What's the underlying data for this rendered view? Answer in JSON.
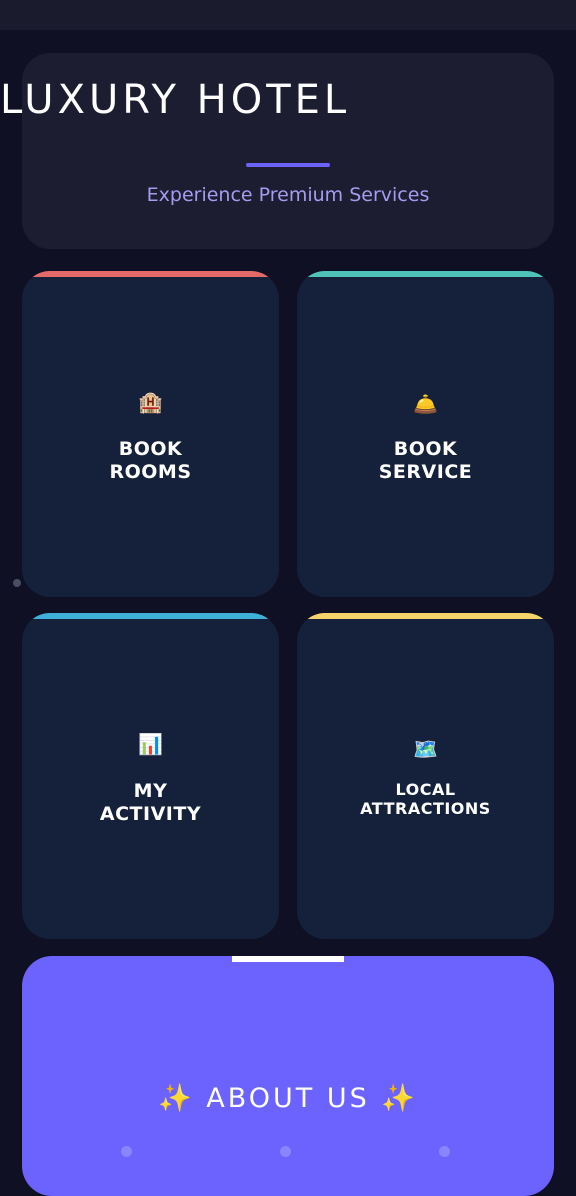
{
  "header": {
    "title": "LUXURY HOTEL",
    "subtitle": "Experience Premium Services"
  },
  "tiles": [
    {
      "icon": "🏨",
      "icon_name": "hotel-icon",
      "label_line1": "BOOK",
      "label_line2": "ROOMS",
      "accent": "#e46a6a"
    },
    {
      "icon": "🛎️",
      "icon_name": "service-bell-icon",
      "label_line1": "BOOK",
      "label_line2": "SERVICE",
      "accent": "#4fc3b8"
    },
    {
      "icon": "📊",
      "icon_name": "bar-chart-icon",
      "label_line1": "MY",
      "label_line2": "ACTIVITY",
      "accent": "#3fb0d8"
    },
    {
      "icon": "🗺️",
      "icon_name": "world-map-icon",
      "label_line1": "LOCAL",
      "label_line2": "ATTRACTIONS",
      "accent": "#f5d36b"
    }
  ],
  "about": {
    "title": "✨ ABOUT US ✨"
  },
  "colors": {
    "background": "#0f1023",
    "card": "#15203a",
    "header_card": "#1c1d30",
    "accent_primary": "#6c63ff",
    "subtitle": "#a59cf0"
  }
}
